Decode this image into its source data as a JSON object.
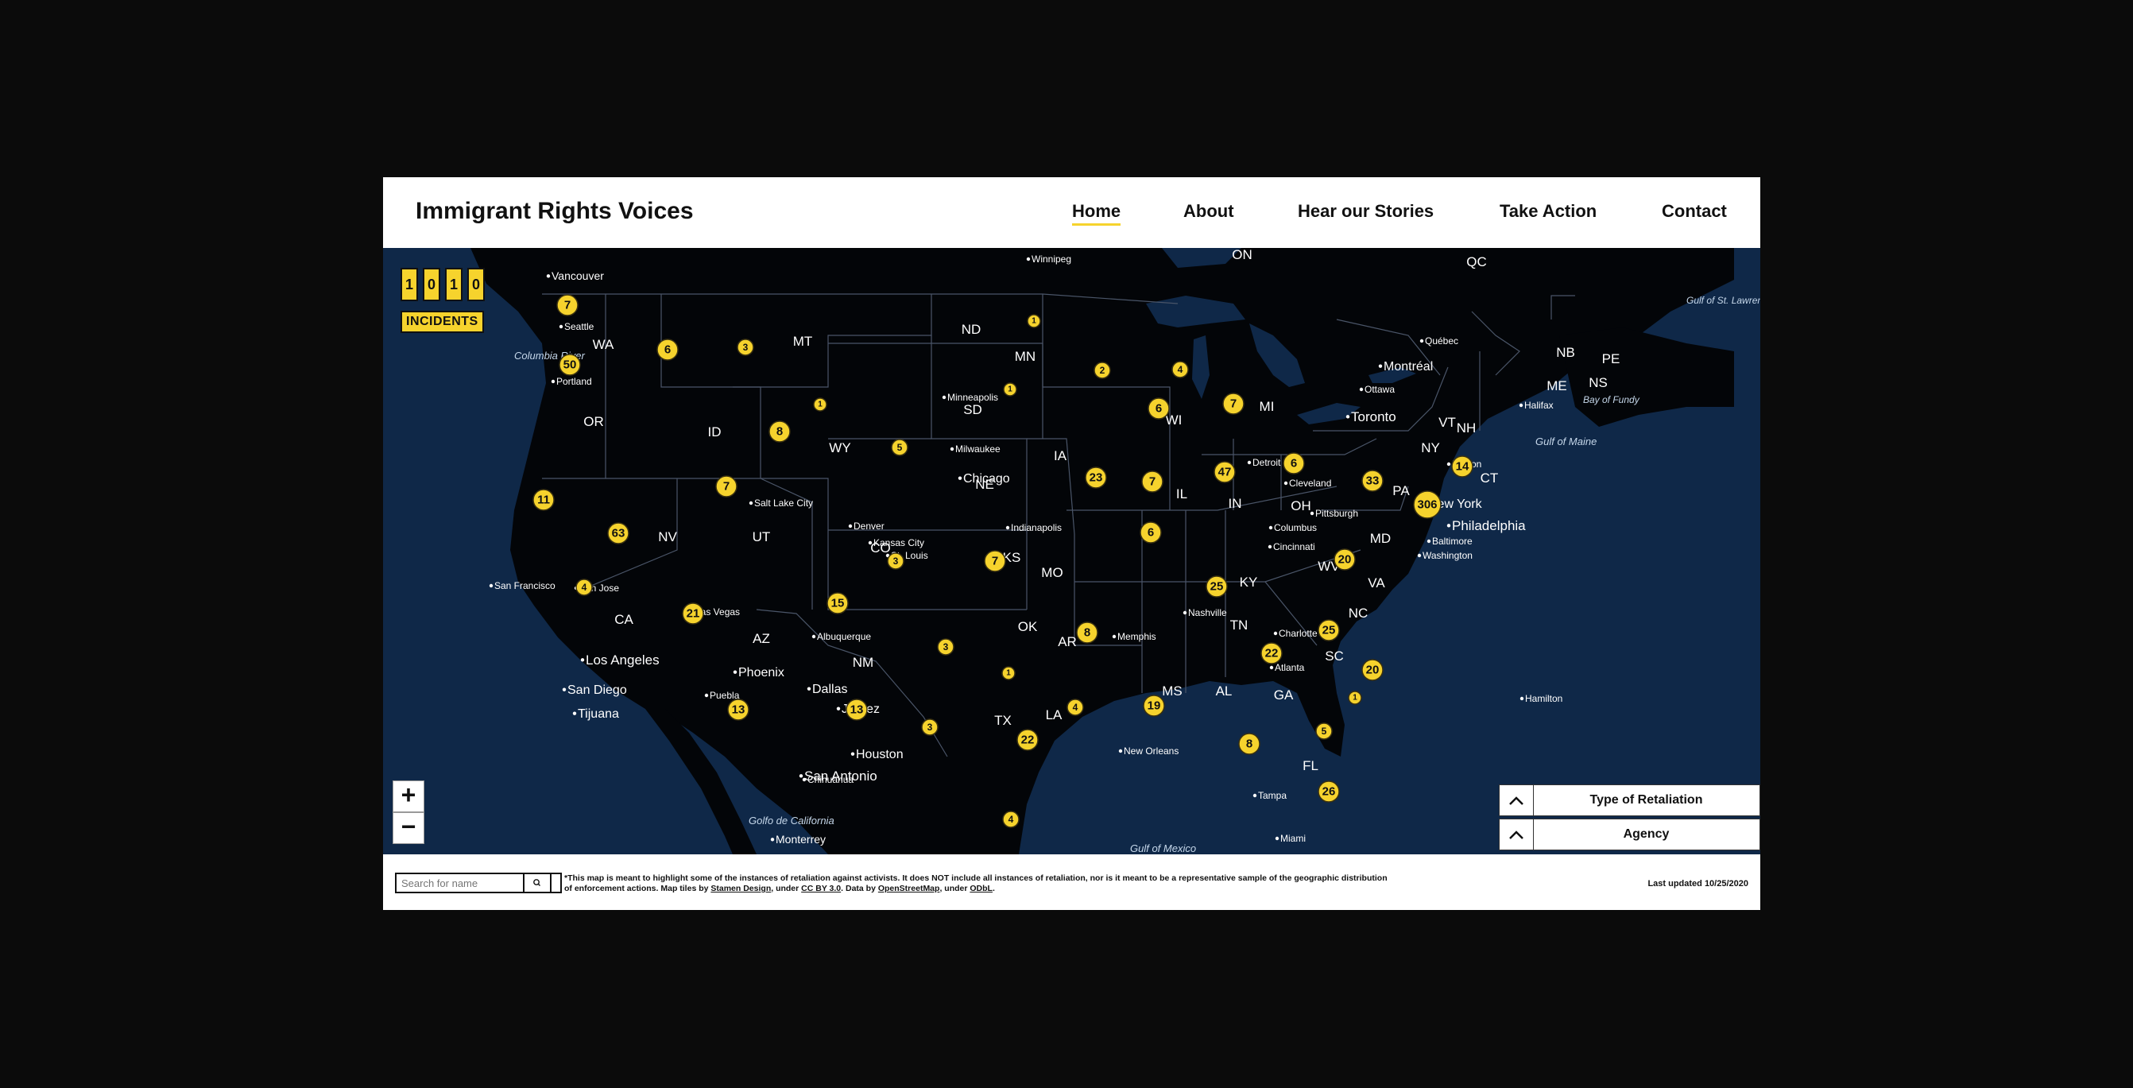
{
  "header": {
    "site_title": "Immigrant Rights Voices",
    "nav": [
      {
        "label": "Home",
        "active": true
      },
      {
        "label": "About"
      },
      {
        "label": "Hear our Stories"
      },
      {
        "label": "Take Action"
      },
      {
        "label": "Contact"
      }
    ]
  },
  "counter": {
    "digits": [
      "1",
      "0",
      "1",
      "0"
    ],
    "label": "INCIDENTS"
  },
  "map": {
    "zoom_in": "+",
    "zoom_out": "−",
    "state_labels": [
      "WA",
      "OR",
      "CA",
      "NV",
      "ID",
      "MT",
      "WY",
      "UT",
      "AZ",
      "NM",
      "CO",
      "ND",
      "SD",
      "NE",
      "KS",
      "OK",
      "TX",
      "MN",
      "IA",
      "MO",
      "AR",
      "LA",
      "WI",
      "IL",
      "MS",
      "AL",
      "TN",
      "KY",
      "IN",
      "MI",
      "OH",
      "GA",
      "FL",
      "SC",
      "NC",
      "VA",
      "WV",
      "PA",
      "NY",
      "MD",
      "VT",
      "NH",
      "ME",
      "CT",
      "NB",
      "NS",
      "PE",
      "ON",
      "QC"
    ],
    "cities": [
      "Vancouver",
      "Seattle",
      "Portland",
      "San Francisco",
      "San Jose",
      "Los Angeles",
      "San Diego",
      "Tijuana",
      "Las Vegas",
      "Phoenix",
      "Salt Lake City",
      "Denver",
      "Albuquerque",
      "Juarez",
      "Chihuahua",
      "Monterrey",
      "San Antonio",
      "Houston",
      "Dallas",
      "Kansas City",
      "St. Louis",
      "Minneapolis",
      "Milwaukee",
      "Chicago",
      "Indianapolis",
      "Detroit",
      "Cincinnati",
      "Columbus",
      "Cleveland",
      "Pittsburgh",
      "Washington",
      "Baltimore",
      "Philadelphia",
      "New York",
      "Boston",
      "Toronto",
      "Ottawa",
      "Montréal",
      "Québec",
      "Halifax",
      "Hamilton",
      "Nashville",
      "Memphis",
      "New Orleans",
      "Atlanta",
      "Charlotte",
      "Tampa",
      "Miami",
      "Winnipeg",
      "Puebla"
    ],
    "water_labels": [
      "Columbia River",
      "Gulf of St. Lawrence",
      "Bay of Fundy",
      "Gulf of Maine",
      "Golfo de California",
      "Gulf of Mexico"
    ],
    "clusters": [
      "7",
      "50",
      "6",
      "3",
      "1",
      "1",
      "1",
      "2",
      "4",
      "6",
      "7",
      "8",
      "5",
      "23",
      "7",
      "6",
      "47",
      "7",
      "11",
      "63",
      "4",
      "21",
      "6",
      "3",
      "7",
      "15",
      "25",
      "20",
      "33",
      "14",
      "306",
      "25",
      "20",
      "3",
      "1",
      "8",
      "13",
      "13",
      "3",
      "4",
      "22",
      "19",
      "22",
      "8",
      "5",
      "1",
      "4",
      "26"
    ]
  },
  "filters": [
    {
      "label": "Type of Retaliation"
    },
    {
      "label": "Agency"
    }
  ],
  "footer": {
    "search_placeholder": "Search for name",
    "disclaimer_main": "*This map is meant to highlight some of the instances of retaliation against activists. It does NOT include all instances of retaliation, nor is it meant to be a representative sample of the geographic distribution of enforcement actions. Map tiles by ",
    "link_stamen": "Stamen Design",
    "text_under1": ", under ",
    "link_cc": "CC BY 3.0",
    "text_data": ". Data by ",
    "link_osm": "OpenStreetMap",
    "text_under2": ", under ",
    "link_odbl": "ODbL",
    "text_end": ".",
    "last_updated": "Last updated 10/25/2020"
  },
  "colors": {
    "accent": "#f6d32d",
    "ocean": "#0f2848",
    "land": "#030508"
  }
}
